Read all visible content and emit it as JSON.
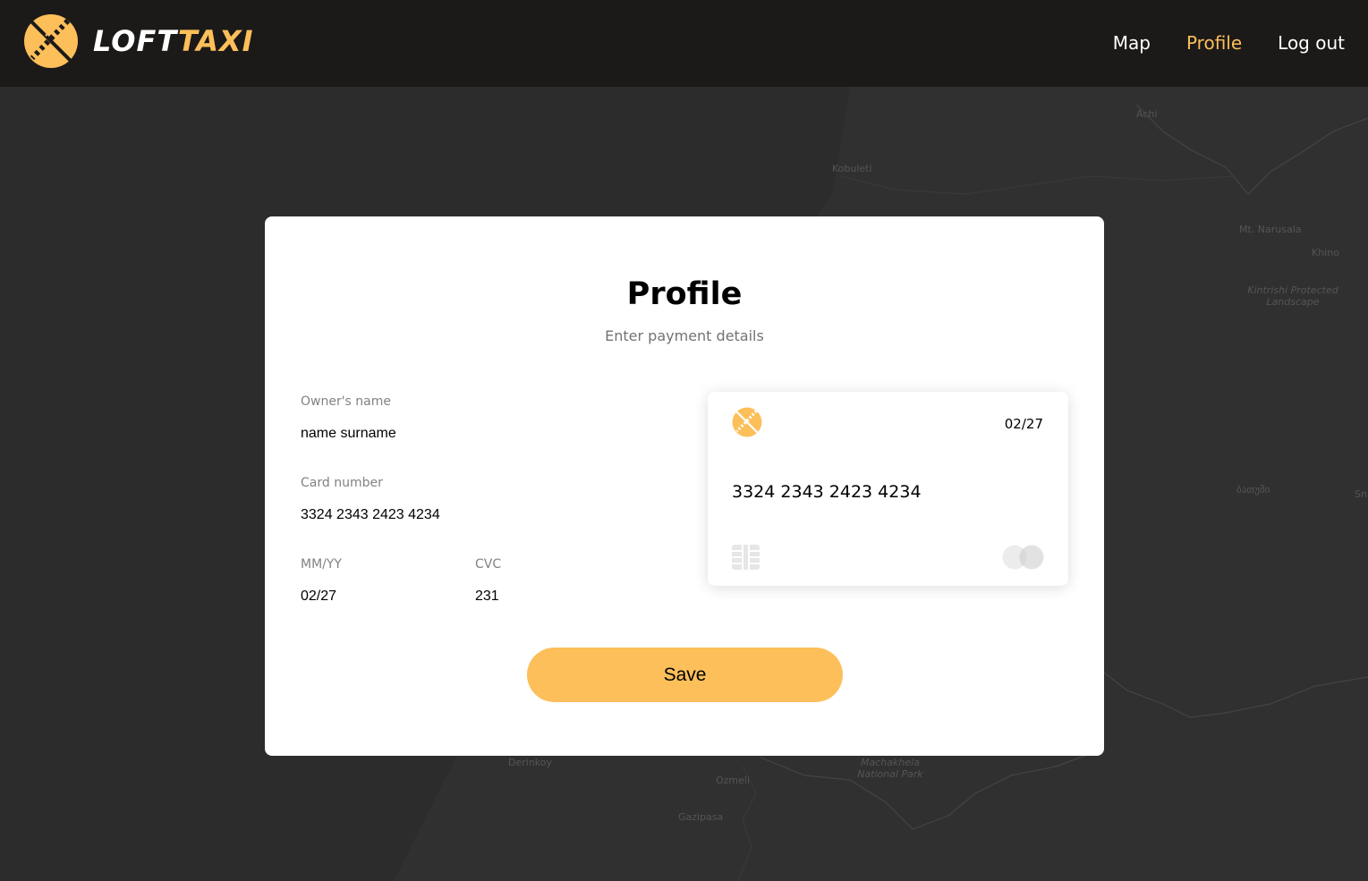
{
  "brand": {
    "name_part1": "LOFT",
    "name_part2": "TAXI",
    "accent_color": "#fdbf5a",
    "logo_icon": "loft-taxi-logo-icon"
  },
  "nav": {
    "items": [
      {
        "label": "Map",
        "active": false
      },
      {
        "label": "Profile",
        "active": true
      },
      {
        "label": "Log out",
        "active": false
      }
    ]
  },
  "map": {
    "labels": [
      "Achi",
      "Kobuleti",
      "Mt. Narusala",
      "Khino",
      "Kintrishi Protected Landscape",
      "ბათუმი",
      "Sn",
      "Derinkoy",
      "Ozmeli",
      "Machakhela National Park",
      "Gazipasa"
    ]
  },
  "profile": {
    "title": "Profile",
    "subtitle": "Enter payment details",
    "fields": {
      "owner": {
        "label": "Owner's name",
        "value": "name surname"
      },
      "card_number": {
        "label": "Card number",
        "value": "3324 2343 2423 4234"
      },
      "expiry": {
        "label": "MM/YY",
        "value": "02/27"
      },
      "cvc": {
        "label": "CVC",
        "value": "231"
      }
    },
    "card": {
      "expiry": "02/27",
      "number": "3324 2343 2423 4234",
      "chip_icon": "card-chip-icon",
      "brand_icon": "mastercard-icon"
    },
    "save_label": "Save"
  }
}
